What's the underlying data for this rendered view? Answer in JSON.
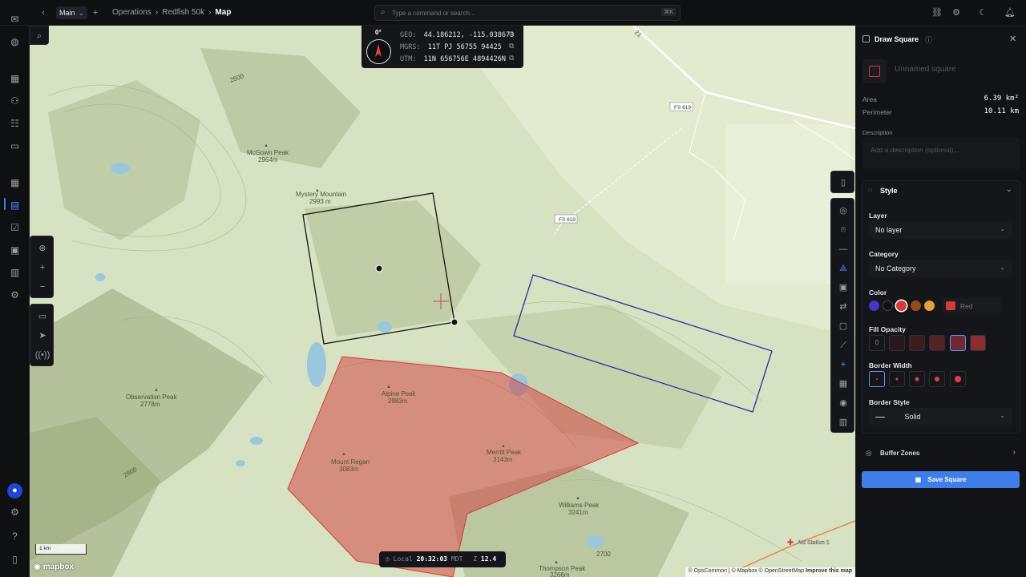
{
  "topbar": {
    "workspace": "Main",
    "breadcrumb": [
      "Operations",
      "Redfish 50k",
      "Map"
    ],
    "command_placeholder": "Type a command or search...",
    "command_shortcut": "⌘K"
  },
  "coords": {
    "heading": "0°",
    "geo_label": "GEO:",
    "geo": "44.186212, -115.038673",
    "mgrs_label": "MGRS:",
    "mgrs": "11T PJ 56755 94425",
    "utm_label": "UTM:",
    "utm": "11N 656756E 4894426N"
  },
  "map_labels": {
    "mcgown_name": "McGown Peak",
    "mcgown_elev": "2964m",
    "mystery_name": "Mystery Mountain",
    "mystery_elev": "2993 m",
    "observation_name": "Observation Peak",
    "observation_elev": "2778m",
    "alpine_name": "Alpine Peak",
    "alpine_elev": "2983m",
    "regan_name": "Mount Regan",
    "regan_elev": "3083m",
    "merritt_name": "Merritt Peak",
    "merritt_elev": "3143m",
    "williams_name": "Williams Peak",
    "williams_elev": "3241m",
    "thompson_name": "Thompson Peak",
    "thompson_elev": "3266m",
    "fs619_a": "FS 619",
    "fs619_b": "FS 619",
    "road_21": "21",
    "aid_station": "Aid Station 1",
    "contour_2500": "2500",
    "contour_2800": "2800",
    "contour_2700": "2700"
  },
  "footer": {
    "scale": "1 km",
    "mapbox": "mapbox",
    "time_label": "Local",
    "time": "20:32:03",
    "tz": "MDT",
    "zoom_label": "Z",
    "zoom": "12.4",
    "attribution": "© OpsCommon | © Mapbox © OpenStreetMap",
    "improve": "Improve this map"
  },
  "panel": {
    "title": "Draw Square",
    "name_placeholder": "Unnamed square",
    "area_label": "Area",
    "area": "6.39 km²",
    "perimeter_label": "Perimeter",
    "perimeter": "10.11 km",
    "description_label": "Description",
    "description_placeholder": "Add a description (optional)...",
    "style_title": "Style",
    "layer_label": "Layer",
    "layer_value": "No layer",
    "category_label": "Category",
    "category_value": "No Category",
    "color_label": "Color",
    "color_value": "Red",
    "fill_opacity_label": "Fill Opacity",
    "fill_opacity_first": "0",
    "border_width_label": "Border Width",
    "border_style_label": "Border Style",
    "border_style_value": "Solid",
    "buffer_zones": "Buffer Zones",
    "save_label": "Save Square"
  },
  "colors": {
    "accent": "#3f7ee8",
    "red": "#d33a3a",
    "blue": "#2d2ca0",
    "swatches": [
      "#4338ca",
      "#111111",
      "#d33a3a",
      "#9a4a1e",
      "#e0a23a"
    ]
  }
}
